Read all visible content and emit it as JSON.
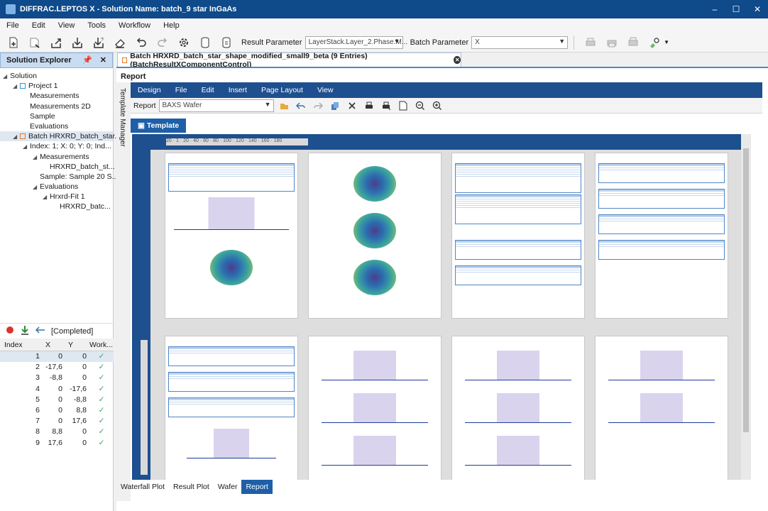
{
  "window": {
    "title": "DIFFRAC.LEPTOS X - Solution Name: batch_9 star InGaAs",
    "min": "–",
    "max": "☐",
    "close": "✕"
  },
  "menu": [
    "File",
    "Edit",
    "View",
    "Tools",
    "Workflow",
    "Help"
  ],
  "toolbar": {
    "result_label": "Result Parameter",
    "result_value": "LayerStack.Layer_2.Phase.M...",
    "batch_label": "Batch Parameter",
    "batch_value": "X"
  },
  "explorer": {
    "title": "Solution Explorer",
    "tree": [
      {
        "label": "Solution",
        "level": 0,
        "toggle": "◢"
      },
      {
        "label": "Project 1",
        "level": 1,
        "toggle": "◢",
        "icon": "project"
      },
      {
        "label": "Measurements",
        "level": 2
      },
      {
        "label": "Measurements 2D",
        "level": 2
      },
      {
        "label": "Sample",
        "level": 2
      },
      {
        "label": "Evaluations",
        "level": 2
      },
      {
        "label": "Batch HRXRD_batch_star...",
        "level": 1,
        "toggle": "◢",
        "icon": "batch",
        "selected": true
      },
      {
        "label": "Index: 1; X: 0; Y: 0; Ind...",
        "level": 2,
        "toggle": "◢"
      },
      {
        "label": "Measurements",
        "level": 3,
        "toggle": "◢"
      },
      {
        "label": "HRXRD_batch_st...",
        "level": 4
      },
      {
        "label": "Sample: Sample 20 S...",
        "level": 3
      },
      {
        "label": "Evaluations",
        "level": 3,
        "toggle": "◢"
      },
      {
        "label": "Hrxrd-Fit 1",
        "level": 4,
        "toggle": "◢"
      },
      {
        "label": "HRXRD_batc...",
        "level": 5
      }
    ],
    "status": "[Completed]",
    "grid": {
      "headers": [
        "Index",
        "X",
        "Y",
        "Work..."
      ],
      "rows": [
        [
          "1",
          "0",
          "0",
          "✓"
        ],
        [
          "2",
          "-17,6",
          "0",
          "✓"
        ],
        [
          "3",
          "-8,8",
          "0",
          "✓"
        ],
        [
          "4",
          "0",
          "-17,6",
          "✓"
        ],
        [
          "5",
          "0",
          "-8,8",
          "✓"
        ],
        [
          "6",
          "0",
          "8,8",
          "✓"
        ],
        [
          "7",
          "0",
          "17,6",
          "✓"
        ],
        [
          "8",
          "8,8",
          "0",
          "✓"
        ],
        [
          "9",
          "17,6",
          "0",
          "✓"
        ]
      ]
    }
  },
  "doc_tab": "Batch HRXRD_batch_star_shape_modified_small9_beta (9 Entries) (BatchResultXComponentControl)",
  "report": {
    "title": "Report",
    "side_label": "Template Manager",
    "menu": [
      "Design",
      "File",
      "Edit",
      "Insert",
      "Page Layout",
      "View"
    ],
    "report_label": "Report",
    "report_value": "BAXS Wafer",
    "template_tab": "Template",
    "ruler": "20 · 1 · 20 · 40 · 60 · 80 · 100 · 120 · 140 · 160 · 180"
  },
  "bottom_tabs": [
    "Waterfall Plot",
    "Result Plot",
    "Wafer",
    "Report"
  ],
  "colors": {
    "title_bar": "#0f4a8a",
    "accent": "#1e5fa8",
    "report_canvas": "#1e4f8f",
    "check": "#3aa25a"
  }
}
